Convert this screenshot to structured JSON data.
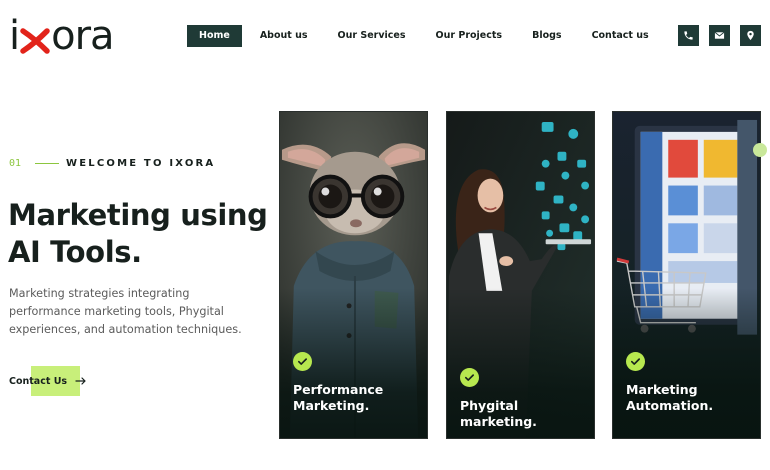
{
  "brand": {
    "logo_left": "i",
    "logo_right": "ora",
    "accent_green": "#8cc63f",
    "cta_green": "#c8ef7a",
    "dark_teal": "#1f3a36",
    "logo_red": "#e2231a"
  },
  "nav": {
    "items": [
      {
        "label": "Home",
        "active": true
      },
      {
        "label": "About us",
        "active": false
      },
      {
        "label": "Our Services",
        "active": false
      },
      {
        "label": "Our Projects",
        "active": false
      },
      {
        "label": "Blogs",
        "active": false
      },
      {
        "label": "Contact us",
        "active": false
      }
    ]
  },
  "header_icons": [
    "phone-icon",
    "envelope-icon",
    "location-pin-icon"
  ],
  "hero": {
    "eyebrow_number": "01",
    "eyebrow_text": "WELCOME TO IXORA",
    "title_line1": "Marketing using",
    "title_line2": "AI Tools.",
    "description": "Marketing strategies integrating performance marketing tools, Phygital experiences, and automation techniques.",
    "cta_label": "Contact Us"
  },
  "cards": [
    {
      "title_line1": "Performance",
      "title_line2": "Marketing.",
      "icon": "check-circle-icon",
      "image": "rabbit-with-glasses"
    },
    {
      "title_line1": "Phygital marketing.",
      "title_line2": "",
      "icon": "check-circle-icon",
      "image": "woman-with-tablet"
    },
    {
      "title_line1": "Marketing",
      "title_line2": "Automation.",
      "icon": "check-circle-icon",
      "image": "shopping-cart-screen"
    }
  ]
}
